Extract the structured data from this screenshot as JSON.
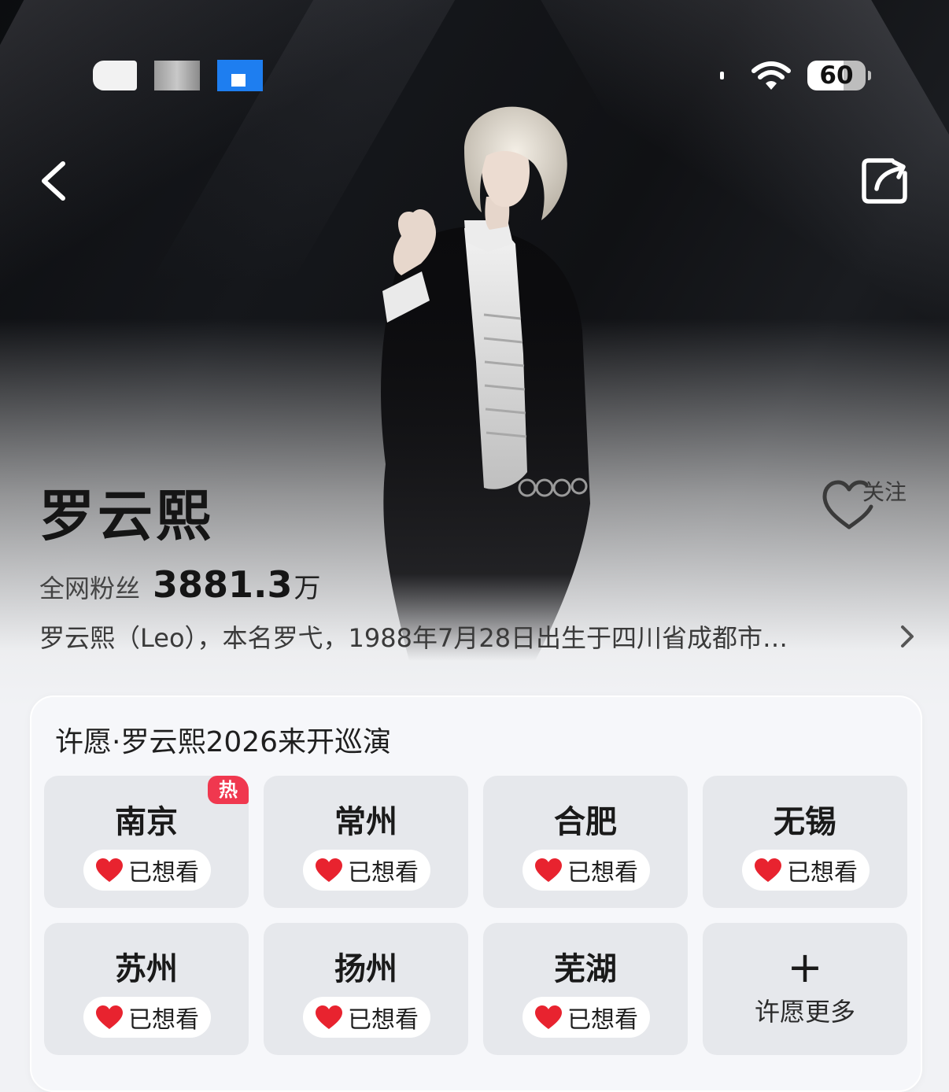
{
  "status_bar": {
    "battery": "60"
  },
  "artist": {
    "name": "罗云熙",
    "follow_label": "关注",
    "fans_label": "全网粉丝",
    "fans_count": "3881.3",
    "fans_unit": "万",
    "bio": "罗云熙（Leo），本名罗弋，1988年7月28日出生于四川省成都市…"
  },
  "wish_card": {
    "title": "许愿·罗云熙2026来开巡演",
    "cities": [
      {
        "name": "南京",
        "status": "已想看",
        "badge": "热"
      },
      {
        "name": "常州",
        "status": "已想看"
      },
      {
        "name": "合肥",
        "status": "已想看"
      },
      {
        "name": "无锡",
        "status": "已想看"
      },
      {
        "name": "苏州",
        "status": "已想看"
      },
      {
        "name": "扬州",
        "status": "已想看"
      },
      {
        "name": "芜湖",
        "status": "已想看"
      }
    ],
    "more": {
      "icon": "+",
      "label": "许愿更多"
    }
  },
  "colors": {
    "hot_badge": "#f0384f",
    "heart": "#e8232f",
    "tile_bg": "#e6e8ec"
  },
  "icons": [
    "back-icon",
    "share-icon",
    "wifi-icon",
    "follow-heart-icon",
    "heart-icon",
    "chevron-right-icon",
    "plus-icon"
  ]
}
